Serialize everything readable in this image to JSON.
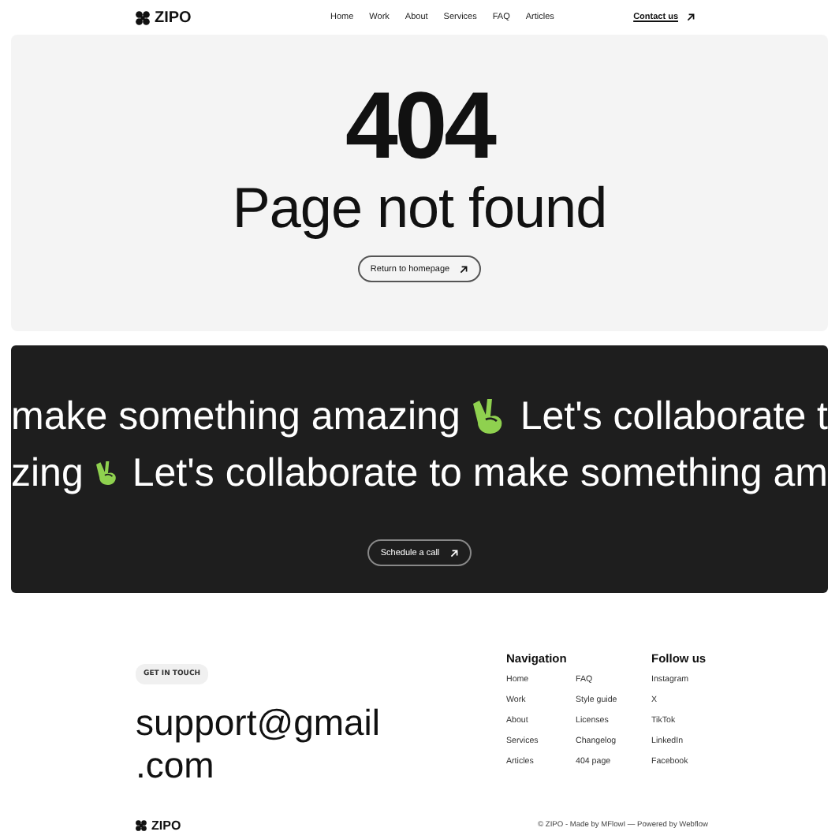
{
  "header": {
    "logo": "ZIPO",
    "nav": [
      "Home",
      "Work",
      "About",
      "Services",
      "FAQ",
      "Articles"
    ],
    "contact": "Contact us"
  },
  "hero": {
    "code": "404",
    "title": "Page not found",
    "button": "Return to homepage"
  },
  "marquee": {
    "lines": [
      [
        "make something amazing",
        "Let's collaborate t"
      ],
      [
        "zing",
        "Let's collaborate to make something am"
      ]
    ],
    "button": "Schedule a call"
  },
  "footer": {
    "badge": "GET IN TOUCH",
    "email": [
      "support@gmail",
      ".com"
    ],
    "columns": [
      {
        "title": "Navigation",
        "items": [
          [
            "Home",
            "Work",
            "About",
            "Services",
            "Articles"
          ],
          [
            "FAQ",
            "Style guide",
            "Licenses",
            "Changelog",
            "404 page"
          ]
        ]
      },
      {
        "title": "Follow us",
        "items": [
          [
            "Instagram",
            "X",
            "TikTok",
            "LinkedIn",
            "Facebook"
          ]
        ]
      }
    ],
    "logo": "ZIPO",
    "copyright": "© ZIPO - Made by MFlowI — Powered by Webflow"
  }
}
